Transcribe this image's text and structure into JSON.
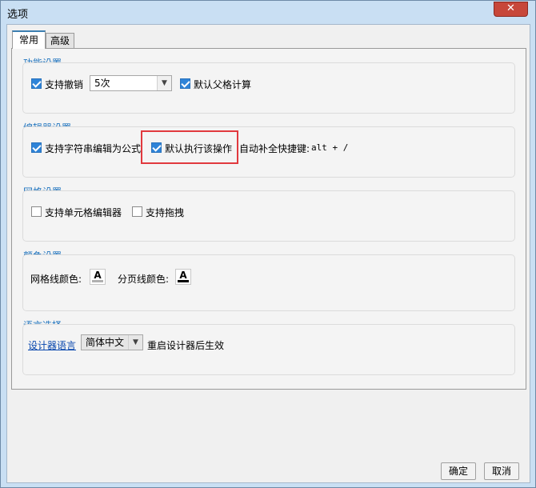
{
  "window": {
    "title": "选项",
    "close_label": "✕"
  },
  "tabs": [
    {
      "label": "常用"
    },
    {
      "label": "高级"
    }
  ],
  "groups": {
    "function": {
      "title": "功能设置",
      "undo_label": "支持撤销",
      "undo_checked": true,
      "undo_steps_value": "5次",
      "parent_calc_label": "默认父格计算",
      "parent_calc_checked": true
    },
    "editor": {
      "title": "编辑器设置",
      "string_formula_label": "支持字符串编辑为公式",
      "string_formula_checked": true,
      "default_exec_label": "默认执行该操作",
      "default_exec_checked": true,
      "autocomplete_label": "自动补全快捷键:",
      "autocomplete_keys": "alt + /"
    },
    "grid": {
      "title": "网格设置",
      "cell_editor_label": "支持单元格编辑器",
      "cell_editor_checked": false,
      "drag_label": "支持拖拽",
      "drag_checked": false
    },
    "color": {
      "title": "颜色设置",
      "gridline_label": "网格线颜色:",
      "gridline_color": "#b0b0b0",
      "pagebreak_label": "分页线颜色:",
      "pagebreak_color": "#000000",
      "glyph": "A"
    },
    "language": {
      "title": "语言选择",
      "designer_language_label": "设计器语言",
      "language_value": "简体中文",
      "restart_note": "重启设计器后生效"
    }
  },
  "buttons": {
    "ok": "确定",
    "cancel": "取消"
  },
  "colors": {
    "accent": "#1e73be",
    "checkbox": "#2f84d8",
    "highlight": "#e1393e"
  }
}
